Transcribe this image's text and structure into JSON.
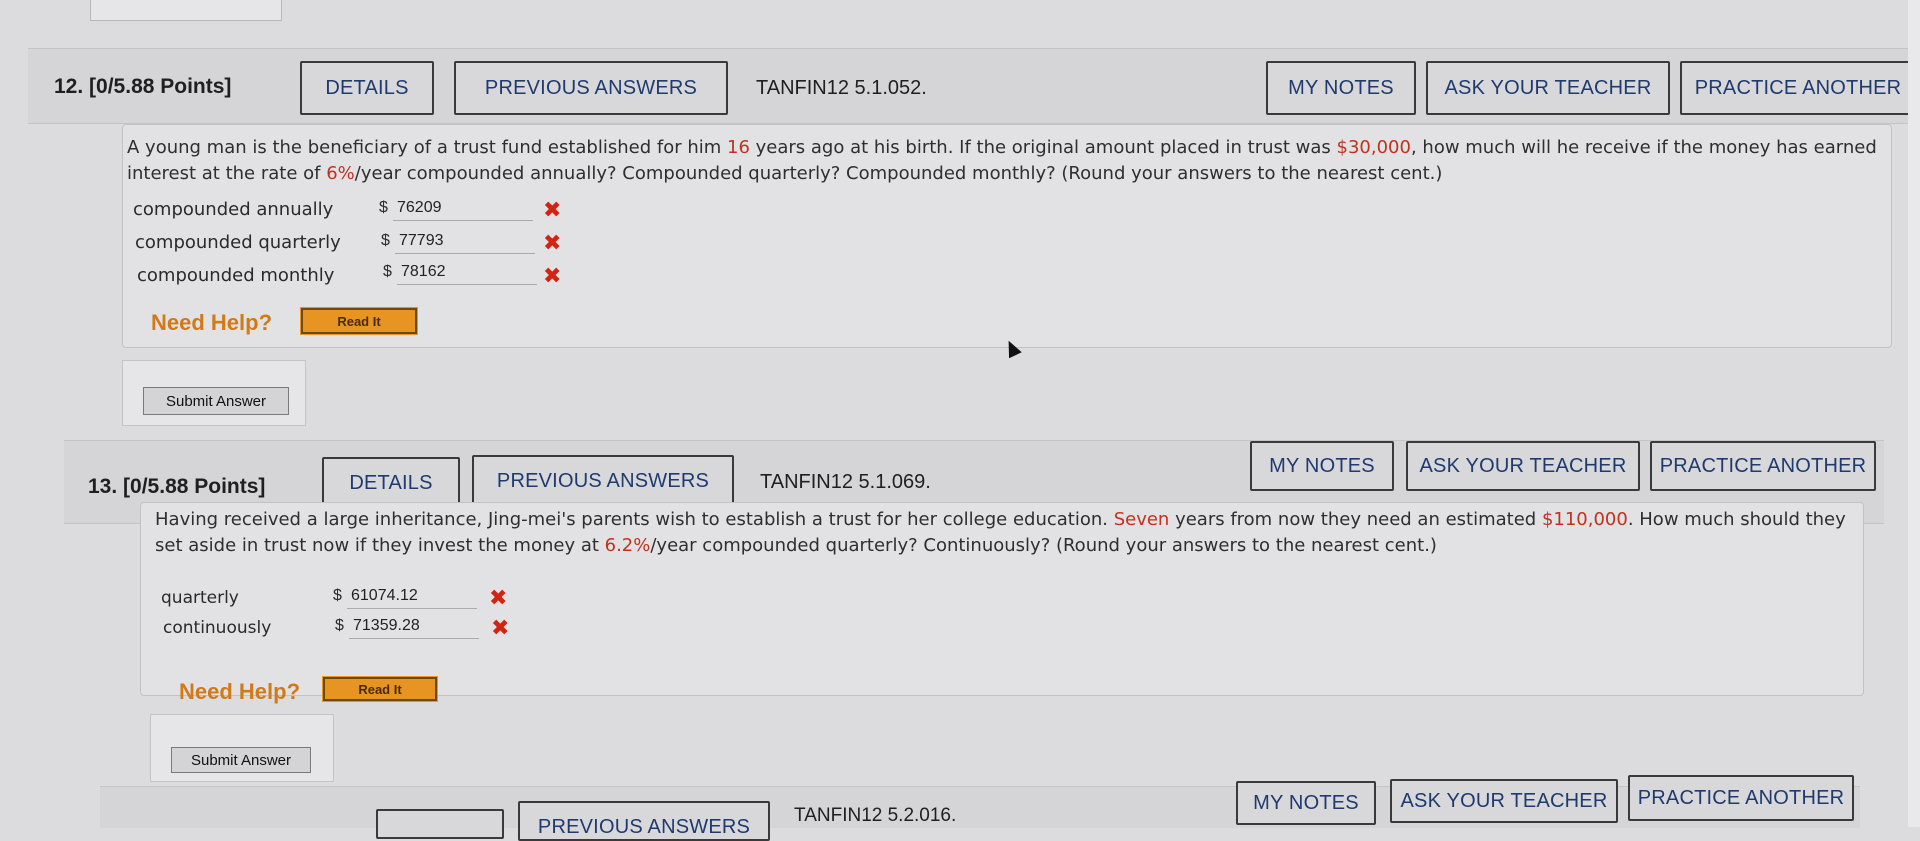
{
  "questions": [
    {
      "number": "12.",
      "points": "[0/5.88 Points]",
      "details_label": "DETAILS",
      "previous_label": "PREVIOUS ANSWERS",
      "code": "TANFIN12 5.1.052.",
      "my_notes_label": "MY NOTES",
      "ask_teacher_label": "ASK YOUR TEACHER",
      "practice_label": "PRACTICE ANOTHER",
      "text_parts": {
        "p1": "A young man is the beneficiary of a trust fund established for him ",
        "v1": "16",
        "p2": " years ago at his birth. If the original amount placed in trust was ",
        "v2": "$30,000",
        "p3": ", how much will he receive if the money has earned interest at the rate of ",
        "v3": "6%",
        "p4": "/year compounded annually? Compounded quarterly? Compounded monthly? (Round your answers to the nearest cent.)"
      },
      "answers": [
        {
          "label": "compounded annually",
          "currency": "$",
          "value": "76209",
          "status": "incorrect"
        },
        {
          "label": "compounded quarterly",
          "currency": "$",
          "value": "77793",
          "status": "incorrect"
        },
        {
          "label": "compounded monthly",
          "currency": "$",
          "value": "78162",
          "status": "incorrect"
        }
      ],
      "need_help": "Need Help?",
      "read_it": "Read It",
      "submit_label": "Submit Answer"
    },
    {
      "number": "13.",
      "points": "[0/5.88 Points]",
      "details_label": "DETAILS",
      "previous_label": "PREVIOUS ANSWERS",
      "code": "TANFIN12 5.1.069.",
      "my_notes_label": "MY NOTES",
      "ask_teacher_label": "ASK YOUR TEACHER",
      "practice_label": "PRACTICE ANOTHER",
      "text_parts": {
        "p1": "Having received a large inheritance, Jing-mei's parents wish to establish a trust for her college education. ",
        "v1": "Seven",
        "p2": " years from now they need an estimated ",
        "v2": "$110,000",
        "p3": ". How much should they set aside in trust now if they invest the money at ",
        "v3": "6.2%",
        "p4": "/year compounded quarterly? Continuously? (Round your answers to the nearest cent.)"
      },
      "answers": [
        {
          "label": "quarterly",
          "currency": "$",
          "value": "61074.12",
          "status": "incorrect"
        },
        {
          "label": "continuously",
          "currency": "$",
          "value": "71359.28",
          "status": "incorrect"
        }
      ],
      "need_help": "Need Help?",
      "read_it": "Read It",
      "submit_label": "Submit Answer"
    },
    {
      "previous_label": "PREVIOUS ANSWERS",
      "code": "TANFIN12 5.2.016.",
      "my_notes_label": "MY NOTES",
      "ask_teacher_label": "ASK YOUR TEACHER",
      "practice_label": "PRACTICE ANOTHER"
    }
  ],
  "icons": {
    "incorrect": "x-mark-icon",
    "cursor": "mouse-pointer-icon"
  },
  "colors": {
    "button_text": "#1e3a6e",
    "highlight_value": "#c0321e",
    "incorrect_mark": "#d32412",
    "need_help": "#d17a17",
    "read_it_bg": "#e89422"
  }
}
